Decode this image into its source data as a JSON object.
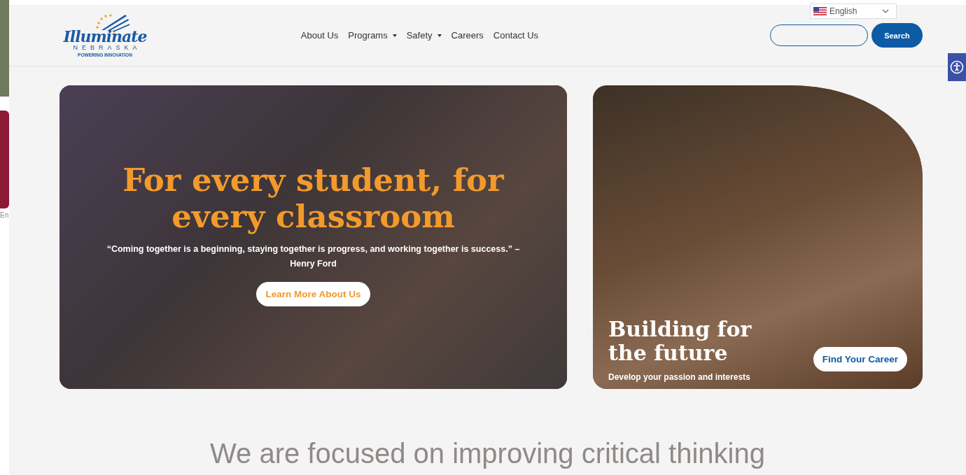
{
  "background_window": {
    "label": "En"
  },
  "header": {
    "logo": {
      "title": "Illuminate",
      "subtitle": "NEBRASKA",
      "tagline": "POWERING INNOVATION"
    },
    "nav": [
      {
        "label": "About Us",
        "dropdown": false
      },
      {
        "label": "Programs",
        "dropdown": true
      },
      {
        "label": "Safety",
        "dropdown": true
      },
      {
        "label": "Careers",
        "dropdown": false
      },
      {
        "label": "Contact Us",
        "dropdown": false
      }
    ],
    "language": {
      "value": "English"
    },
    "search": {
      "button": "Search"
    }
  },
  "hero": {
    "heading": "For every student, for every classroom",
    "quote": "“Coming together is a beginning, staying together is progress, and working together is success.” – Henry Ford",
    "button": "Learn More About Us"
  },
  "career_card": {
    "heading": "Building for the future",
    "subtitle": "Develop your passion and interests",
    "button": "Find Your Career"
  },
  "section": {
    "heading": "We are focused on improving critical thinking"
  }
}
